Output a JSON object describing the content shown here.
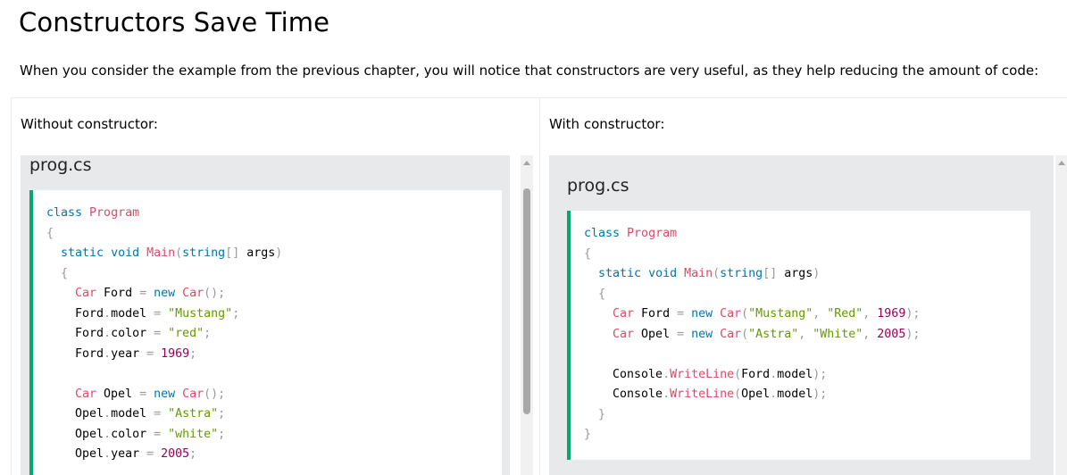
{
  "page": {
    "title": "Constructors Save Time",
    "intro": "When you consider the example from the previous chapter, you will notice that constructors are very useful, as they help reducing the amount of code:"
  },
  "left": {
    "label": "Without constructor:",
    "file_name": "prog.cs",
    "code_lines": [
      [
        [
          "class ",
          "kw"
        ],
        [
          "Program",
          "ty"
        ]
      ],
      [
        [
          "{",
          "pun"
        ]
      ],
      [
        [
          "  static ",
          "kw"
        ],
        [
          "void ",
          "kw"
        ],
        [
          "Main",
          "fn"
        ],
        [
          "(",
          "pun"
        ],
        [
          "string",
          "kw"
        ],
        [
          "[]",
          "pun"
        ],
        [
          " args",
          "pl"
        ],
        [
          ")",
          "pun"
        ]
      ],
      [
        [
          "  {",
          "pun"
        ]
      ],
      [
        [
          "    Car ",
          "ty"
        ],
        [
          "Ford ",
          "pl"
        ],
        [
          "= ",
          "pun"
        ],
        [
          "new ",
          "kw"
        ],
        [
          "Car",
          "ty"
        ],
        [
          "();",
          "pun"
        ]
      ],
      [
        [
          "    Ford",
          "pl"
        ],
        [
          ".",
          "pun"
        ],
        [
          "model ",
          "pl"
        ],
        [
          "= ",
          "pun"
        ],
        [
          "\"Mustang\"",
          "str"
        ],
        [
          ";",
          "pun"
        ]
      ],
      [
        [
          "    Ford",
          "pl"
        ],
        [
          ".",
          "pun"
        ],
        [
          "color ",
          "pl"
        ],
        [
          "= ",
          "pun"
        ],
        [
          "\"red\"",
          "str"
        ],
        [
          ";",
          "pun"
        ]
      ],
      [
        [
          "    Ford",
          "pl"
        ],
        [
          ".",
          "pun"
        ],
        [
          "year ",
          "pl"
        ],
        [
          "= ",
          "pun"
        ],
        [
          "1969",
          "num"
        ],
        [
          ";",
          "pun"
        ]
      ],
      [
        [
          "",
          "pl"
        ]
      ],
      [
        [
          "    Car ",
          "ty"
        ],
        [
          "Opel ",
          "pl"
        ],
        [
          "= ",
          "pun"
        ],
        [
          "new ",
          "kw"
        ],
        [
          "Car",
          "ty"
        ],
        [
          "();",
          "pun"
        ]
      ],
      [
        [
          "    Opel",
          "pl"
        ],
        [
          ".",
          "pun"
        ],
        [
          "model ",
          "pl"
        ],
        [
          "= ",
          "pun"
        ],
        [
          "\"Astra\"",
          "str"
        ],
        [
          ";",
          "pun"
        ]
      ],
      [
        [
          "    Opel",
          "pl"
        ],
        [
          ".",
          "pun"
        ],
        [
          "color ",
          "pl"
        ],
        [
          "= ",
          "pun"
        ],
        [
          "\"white\"",
          "str"
        ],
        [
          ";",
          "pun"
        ]
      ],
      [
        [
          "    Opel",
          "pl"
        ],
        [
          ".",
          "pun"
        ],
        [
          "year ",
          "pl"
        ],
        [
          "= ",
          "pun"
        ],
        [
          "2005",
          "num"
        ],
        [
          ";",
          "pun"
        ]
      ]
    ]
  },
  "right": {
    "label": "With constructor:",
    "file_name": "prog.cs",
    "code_lines": [
      [
        [
          "class ",
          "kw"
        ],
        [
          "Program",
          "ty"
        ]
      ],
      [
        [
          "{",
          "pun"
        ]
      ],
      [
        [
          "  static ",
          "kw"
        ],
        [
          "void ",
          "kw"
        ],
        [
          "Main",
          "fn"
        ],
        [
          "(",
          "pun"
        ],
        [
          "string",
          "kw"
        ],
        [
          "[]",
          "pun"
        ],
        [
          " args",
          "pl"
        ],
        [
          ")",
          "pun"
        ]
      ],
      [
        [
          "  {",
          "pun"
        ]
      ],
      [
        [
          "    Car ",
          "ty"
        ],
        [
          "Ford ",
          "pl"
        ],
        [
          "= ",
          "pun"
        ],
        [
          "new ",
          "kw"
        ],
        [
          "Car",
          "ty"
        ],
        [
          "(",
          "pun"
        ],
        [
          "\"Mustang\"",
          "str"
        ],
        [
          ", ",
          "pun"
        ],
        [
          "\"Red\"",
          "str"
        ],
        [
          ", ",
          "pun"
        ],
        [
          "1969",
          "num"
        ],
        [
          ");",
          "pun"
        ]
      ],
      [
        [
          "    Car ",
          "ty"
        ],
        [
          "Opel ",
          "pl"
        ],
        [
          "= ",
          "pun"
        ],
        [
          "new ",
          "kw"
        ],
        [
          "Car",
          "ty"
        ],
        [
          "(",
          "pun"
        ],
        [
          "\"Astra\"",
          "str"
        ],
        [
          ", ",
          "pun"
        ],
        [
          "\"White\"",
          "str"
        ],
        [
          ", ",
          "pun"
        ],
        [
          "2005",
          "num"
        ],
        [
          ");",
          "pun"
        ]
      ],
      [
        [
          "",
          "pl"
        ]
      ],
      [
        [
          "    Console",
          "pl"
        ],
        [
          ".",
          "pun"
        ],
        [
          "WriteLine",
          "fn"
        ],
        [
          "(",
          "pun"
        ],
        [
          "Ford",
          "pl"
        ],
        [
          ".",
          "pun"
        ],
        [
          "model",
          "pl"
        ],
        [
          ");",
          "pun"
        ]
      ],
      [
        [
          "    Console",
          "pl"
        ],
        [
          ".",
          "pun"
        ],
        [
          "WriteLine",
          "fn"
        ],
        [
          "(",
          "pun"
        ],
        [
          "Opel",
          "pl"
        ],
        [
          ".",
          "pun"
        ],
        [
          "model",
          "pl"
        ],
        [
          ");",
          "pun"
        ]
      ],
      [
        [
          "  }",
          "pun"
        ]
      ],
      [
        [
          "}",
          "pun"
        ]
      ]
    ]
  },
  "colors": {
    "accent_border": "#04aa6d",
    "panel_bg": "#e7e9eb",
    "keyword": "#0077aa",
    "type": "#dd4a68",
    "string": "#669900",
    "number": "#990055",
    "punctuation": "#999999"
  },
  "icons": {
    "scroll_up": "scroll-up-arrow-icon"
  }
}
